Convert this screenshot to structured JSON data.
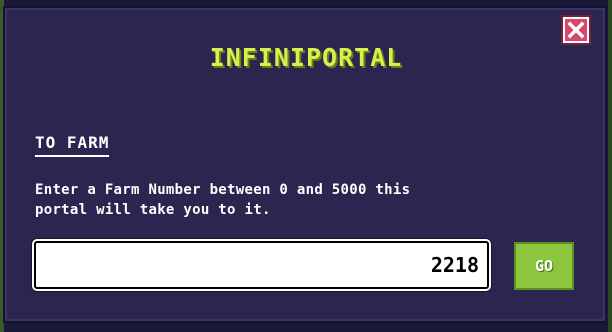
{
  "dialog": {
    "title": "INFINIPORTAL",
    "close_icon": "close-icon",
    "section_heading": "TO FARM",
    "description": "Enter a Farm Number between 0 and 5000 this\nportal will take you to it.",
    "farm_number_value": "2218",
    "go_label": "GO"
  },
  "colors": {
    "panel_background": "#2a2650",
    "title_color": "#d9f04a",
    "close_button": "#d8476b",
    "go_button": "#8cc63f"
  }
}
